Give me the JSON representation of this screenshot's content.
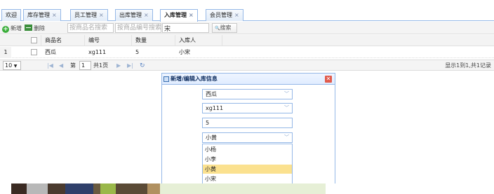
{
  "tabs": [
    {
      "label": "欢迎",
      "closable": false
    },
    {
      "label": "库存管理",
      "closable": true
    },
    {
      "label": "员工管理",
      "closable": true
    },
    {
      "label": "出库管理",
      "closable": true
    },
    {
      "label": "入库管理",
      "closable": true,
      "active": true
    },
    {
      "label": "会员管理",
      "closable": true
    }
  ],
  "tab_close_glyph": "×",
  "toolbar": {
    "add_label": "新增",
    "delete_label": "删除",
    "name_placeholder": "按商品名搜索",
    "code_placeholder": "按商品编号搜索",
    "person_value": "宋",
    "search_label": "搜索",
    "search_icon_glyph": "🔍"
  },
  "grid": {
    "columns": [
      "商品名",
      "编号",
      "数量",
      "入库人"
    ],
    "rows": [
      {
        "num": "1",
        "name": "西瓜",
        "code": "xg111",
        "qty": "5",
        "person": "小宋"
      }
    ]
  },
  "pager": {
    "page_size": "10",
    "page_prefix": "第",
    "page_value": "1",
    "page_suffix": "共1页",
    "summary": "显示1到1,共1记录"
  },
  "dialog": {
    "title": "新增/编辑入库信息",
    "close_glyph": "✕",
    "product_value": "西瓜",
    "code_value": "xg111",
    "qty_value": "5",
    "person_value": "小黄",
    "options": [
      "小杨",
      "小李",
      "小黄",
      "小宋"
    ],
    "selected_option": "小黄"
  },
  "colors": {
    "accent_border": "#95b8e7",
    "selected_option": "#fbe18f",
    "add_icon": "#3bae3b",
    "close_icon": "#e15b4c"
  }
}
